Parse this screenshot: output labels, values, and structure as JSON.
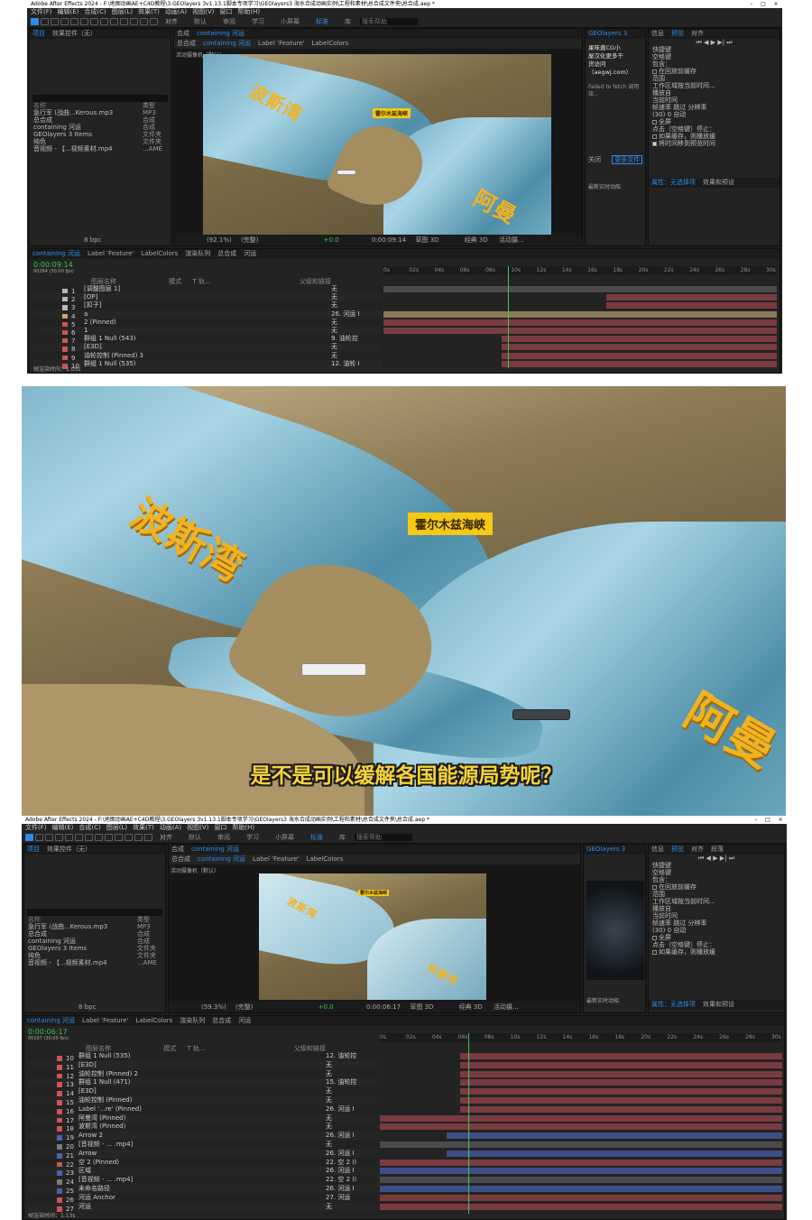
{
  "app": {
    "title": "Adobe After Effects 2024 - F:\\地图动画AE+C4D教程\\3.GEOlayers 3v1.13.1脚本专项学习\\GEOlayers3 海水合成动画实例\\工程和素材\\总合成文件夹\\总合成.aep *",
    "window_controls": [
      "–",
      "□",
      "×"
    ],
    "menu": [
      "文件(F)",
      "编辑(E)",
      "合成(C)",
      "图层(L)",
      "效果(T)",
      "动画(A)",
      "视图(V)",
      "窗口",
      "帮助(H)"
    ],
    "workspaces": [
      "默认",
      "审阅",
      "学习",
      "小屏幕",
      "标准",
      "库"
    ],
    "active_workspace": "标准",
    "search_help": "搜索帮助",
    "snap_label": "对齐"
  },
  "project": {
    "tabs": [
      "项目",
      "效果控件（无）"
    ],
    "col_name": "名称",
    "col_type": "类型",
    "items": [
      {
        "name": "急行军 (战曲...Kerous.mp3",
        "type": "MP3"
      },
      {
        "name": "总合成",
        "type": "合成"
      },
      {
        "name": "containing 河运",
        "type": "合成"
      },
      {
        "name": "GEOlayers 3 Items",
        "type": "文件夹"
      },
      {
        "name": "纯色",
        "type": "文件夹"
      },
      {
        "name": "音视频 - 【...视频素材.mp4",
        "type": "...AME"
      }
    ],
    "bpc": "8 bpc"
  },
  "comp_tabs": {
    "comp_prefix": "合成",
    "comp_name": "containing 河运",
    "crumbs": [
      "总合成",
      "containing 河运"
    ],
    "extra_tabs": [
      "Label 'Feature'",
      "LabelColors"
    ],
    "camera": "活动摄像机（默认）"
  },
  "viewer_bar": {
    "zoom_top": "(92.1%)",
    "zoom_bottom": "(59.3%)",
    "quality": "(完整)",
    "exposure": "+0.0",
    "time_top": "0:00:09:14",
    "time_bottom": "0:00:06:17",
    "renderer": "草图 3D",
    "view": "经典 3D",
    "camera_menu": "活动摄...",
    "views": "1..."
  },
  "map": {
    "label_gulf": "波斯湾",
    "label_oman": "阿曼",
    "label_oman_full": "阿曼湾",
    "label_strait": "霍尔木兹海峡"
  },
  "geolayers_panel": {
    "tab": "GEOlayers 3",
    "promo_lines": [
      "果味酱CG小",
      "屋汉化更多干",
      "货访问",
      "（aegwj.com）"
    ],
    "error_text": "Failed to fetch 调用接...",
    "close_btn": "关闭",
    "new_btn": "更多文件",
    "news": "最新实时动船"
  },
  "preview_panel": {
    "tabs": [
      "信息",
      "预览",
      "对齐"
    ],
    "shortcut_label": "快捷键",
    "shortcut_value": "空格键",
    "include_label": "包含：",
    "cache_label": "在回放前缓存",
    "range_label": "范围",
    "range_value": "工作区域按当前时间...",
    "play_from_label": "播放自",
    "play_from_value": "当前时间",
    "fps_label": "帧速率",
    "skip_label": "跳过",
    "res_label": "分辨率",
    "fps_value": "(30)",
    "skip_value": "0",
    "res_value": "自动",
    "fullscreen": "全屏",
    "stop_label": "点击（空格键）停止：",
    "cache_opt": "如果缓存，则播放缓",
    "move_opt": "将时间移到预览时间",
    "properties": "属性：无选择项",
    "effects": "效果和预设",
    "paragraph": "段落"
  },
  "timeline": {
    "tabs": [
      "containing 河运",
      "Label 'Feature'",
      "LabelColors",
      "渲染队列",
      "总合成",
      "河运"
    ],
    "time_top": "0:00:09:14",
    "frames_top": "00284 (30.00 fps)",
    "time_bottom": "0:00:06:17",
    "frames_bottom": "00197 (30.00 fps)",
    "col_layer": "图层名称",
    "col_mode": "模式",
    "col_trkmat": "T 轨...",
    "col_parent": "父级和链接",
    "render_time_top": "帧渲染时间：1.05s",
    "render_time_bottom": "帧渲染时间：1.13s",
    "ruler": [
      "0s",
      "02s",
      "04s",
      "06s",
      "08s",
      "10s",
      "12s",
      "14s",
      "16s",
      "18s",
      "20s",
      "22s",
      "24s",
      "26s",
      "28s",
      "30s"
    ],
    "playhead_top_sec": 9.47,
    "playhead_bottom_sec": 6.57,
    "duration_sec": 30,
    "layers_top": [
      {
        "n": "1",
        "name": "[调整图层 1]",
        "color": "#b8b8b8",
        "parent": "无",
        "track": "g",
        "start": 0,
        "end": 30
      },
      {
        "n": "2",
        "name": "[OP]",
        "color": "#b8b8b8",
        "parent": "无",
        "track": "r",
        "start": 17,
        "end": 30
      },
      {
        "n": "3",
        "name": "[扣子]",
        "color": "#b8b8b8",
        "parent": "无",
        "track": "r",
        "start": 17,
        "end": 30
      },
      {
        "n": "4",
        "name": "a",
        "color": "#cfa36b",
        "parent": "26. 河运 I",
        "track": "t",
        "start": 0,
        "end": 30
      },
      {
        "n": "5",
        "name": "2 (Pinned)",
        "color": "#cc5555",
        "parent": "无",
        "track": "r",
        "start": 0,
        "end": 30
      },
      {
        "n": "6",
        "name": "1",
        "color": "#cc5555",
        "parent": "无",
        "track": "r",
        "start": 0,
        "end": 30
      },
      {
        "n": "7",
        "name": "群组 1 Null (543)",
        "color": "#cc5555",
        "parent": "9. 油轮控",
        "track": "r",
        "start": 9,
        "end": 30
      },
      {
        "n": "8",
        "name": "[E3D]",
        "color": "#cc5555",
        "parent": "无",
        "track": "r",
        "start": 9,
        "end": 30
      },
      {
        "n": "9",
        "name": "油轮控制 (Pinned) 3",
        "color": "#cc5555",
        "parent": "无",
        "track": "r",
        "start": 9,
        "end": 30
      },
      {
        "n": "10",
        "name": "群组 1 Null (535)",
        "color": "#cc5555",
        "parent": "12. 油轮 I",
        "track": "r",
        "start": 9,
        "end": 30
      }
    ],
    "layers_bottom": [
      {
        "n": "10",
        "name": "群组 1 Null (535)",
        "color": "#cc5555",
        "parent": "12. 油轮控",
        "track": "r",
        "start": 6,
        "end": 30
      },
      {
        "n": "11",
        "name": "[E3D]",
        "color": "#cc5555",
        "parent": "无",
        "track": "r",
        "start": 6,
        "end": 30
      },
      {
        "n": "12",
        "name": "油轮控制 (Pinned) 2",
        "color": "#cc5555",
        "parent": "无",
        "track": "r",
        "start": 6,
        "end": 30
      },
      {
        "n": "13",
        "name": "群组 1 Null (471)",
        "color": "#cc5555",
        "parent": "15. 油轮控",
        "track": "r",
        "start": 6,
        "end": 30
      },
      {
        "n": "14",
        "name": "[E3D]",
        "color": "#cc5555",
        "parent": "无",
        "track": "r",
        "start": 6,
        "end": 30
      },
      {
        "n": "15",
        "name": "油轮控制 (Pinned)",
        "color": "#cc5555",
        "parent": "无",
        "track": "r",
        "start": 6,
        "end": 30
      },
      {
        "n": "16",
        "name": "Label '...re' (Pinned)",
        "color": "#cc5555",
        "parent": "26. 河运 I",
        "track": "r",
        "start": 6,
        "end": 30
      },
      {
        "n": "17",
        "name": "阿曼湾 (Pinned)",
        "color": "#cc5555",
        "parent": "无",
        "track": "r",
        "start": 0,
        "end": 30
      },
      {
        "n": "18",
        "name": "波斯湾 (Pinned)",
        "color": "#cc5555",
        "parent": "无",
        "track": "r",
        "start": 0,
        "end": 30
      },
      {
        "n": "19",
        "name": "Arrow 2",
        "color": "#4c5fb0",
        "parent": "26. 河运 I",
        "track": "b",
        "start": 5,
        "end": 30
      },
      {
        "n": "20",
        "name": "[音视频 - ... .mp4]",
        "color": "#7c7c7c",
        "parent": "无",
        "track": "g",
        "start": 0,
        "end": 30
      },
      {
        "n": "21",
        "name": "Arrow",
        "color": "#4c5fb0",
        "parent": "26. 河运 I",
        "track": "b",
        "start": 5,
        "end": 30
      },
      {
        "n": "22",
        "name": "空 2 (Pinned)",
        "color": "#cc5555",
        "parent": "22. 空 2 (I",
        "track": "r",
        "start": 0,
        "end": 30
      },
      {
        "n": "23",
        "name": "区域",
        "color": "#4c5fb0",
        "parent": "26. 河运 I",
        "track": "b",
        "start": 0,
        "end": 30
      },
      {
        "n": "24",
        "name": "[音视频 - ... .mp4]",
        "color": "#7c7c7c",
        "parent": "22. 空 2 (I",
        "track": "g",
        "start": 0,
        "end": 30
      },
      {
        "n": "25",
        "name": "未命名路径",
        "color": "#4c5fb0",
        "parent": "26. 河运 I",
        "track": "b",
        "start": 0,
        "end": 30
      },
      {
        "n": "26",
        "name": "河运 Anchor",
        "color": "#cc5555",
        "parent": "27. 河运",
        "track": "r",
        "start": 0,
        "end": 30
      },
      {
        "n": "27",
        "name": "河运",
        "color": "#cc5555",
        "parent": "无",
        "track": "r",
        "start": 0,
        "end": 30
      }
    ]
  },
  "video": {
    "subtitle": "是不是可以缓解各国能源局势呢？"
  }
}
